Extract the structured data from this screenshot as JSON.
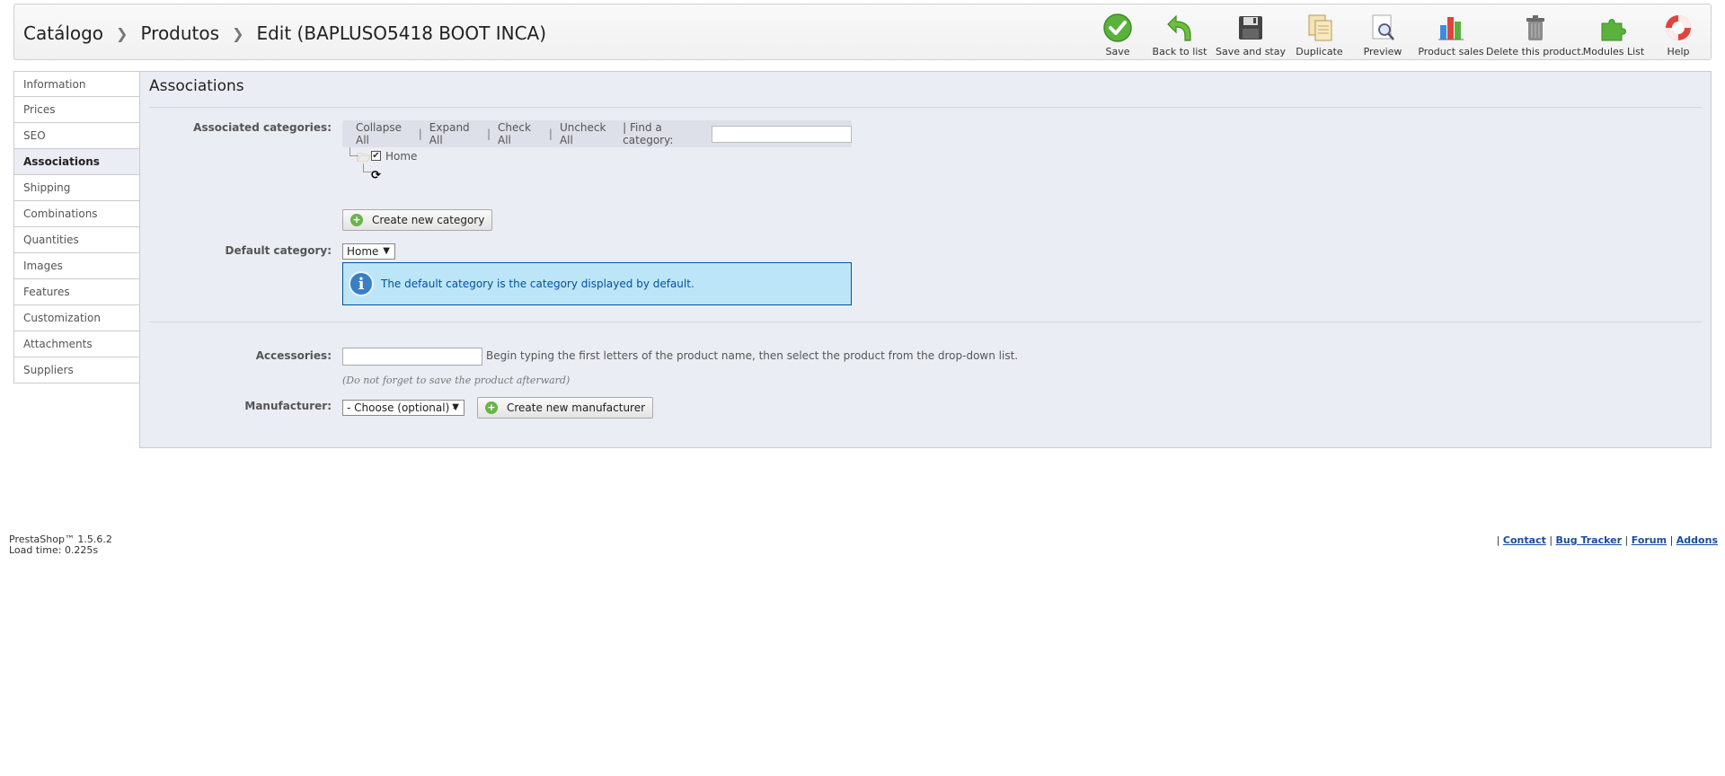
{
  "breadcrumb": {
    "level1": "Catálogo",
    "level2": "Produtos",
    "current": "Edit (BAPLUSO5418 BOOT INCA)"
  },
  "toolbar": {
    "save": "Save",
    "back": "Back to list",
    "save_stay": "Save and stay",
    "duplicate": "Duplicate",
    "preview": "Preview",
    "sales": "Product sales",
    "delete": "Delete this product.",
    "modules": "Modules List",
    "help": "Help"
  },
  "tabs": [
    "Information",
    "Prices",
    "SEO",
    "Associations",
    "Shipping",
    "Combinations",
    "Quantities",
    "Images",
    "Features",
    "Customization",
    "Attachments",
    "Suppliers"
  ],
  "active_tab": "Associations",
  "panel": {
    "title": "Associations",
    "assoc_label": "Associated categories:",
    "collapse": "Collapse All",
    "expand": "Expand All",
    "check": "Check All",
    "uncheck": "Uncheck All",
    "find": "| Find a category:",
    "sep": "|",
    "tree_home": "Home",
    "create_category": "Create new category",
    "default_label": "Default category:",
    "default_value": "Home",
    "info": "The default category is the category displayed by default.",
    "accessories_label": "Accessories:",
    "accessories_hint": "Begin typing the first letters of the product name, then select the product from the drop-down list.",
    "accessories_note": "(Do not forget to save the product afterward)",
    "manufacturer_label": "Manufacturer:",
    "manufacturer_value": "- Choose (optional) -",
    "create_manufacturer": "Create new manufacturer"
  },
  "footer": {
    "version": "PrestaShop™ 1.5.6.2",
    "load": "Load time: 0.225s",
    "contact": "Contact",
    "bug": "Bug Tracker",
    "forum": "Forum",
    "addons": "Addons"
  }
}
